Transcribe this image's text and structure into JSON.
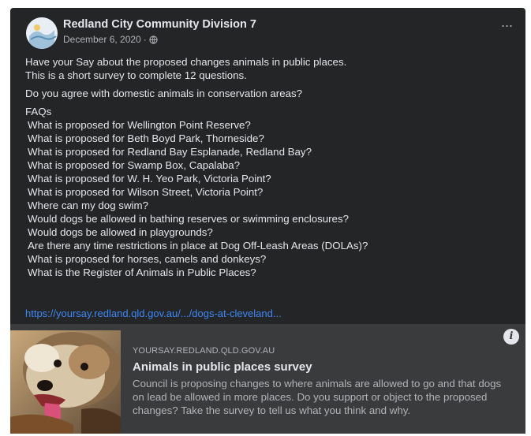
{
  "post": {
    "page_name": "Redland City Community Division 7",
    "date": "December 6, 2020",
    "separator": "·",
    "privacy_icon": "globe-icon",
    "more_icon": "more-options-icon",
    "more_label": "···",
    "intro_line1": "Have your Say about the proposed changes animals in public places.",
    "intro_line2": "This is a short survey to complete 12 questions.",
    "question": "Do you agree with domestic animals in conservation areas?",
    "faq_heading": "FAQs",
    "faqs": [
      "What is proposed for Wellington Point Reserve?",
      "What is proposed for Beth Boyd Park, Thorneside?",
      "What is proposed for Redland Bay Esplanade, Redland Bay?",
      "What is proposed for Swamp Box, Capalaba?",
      "What is proposed for W. H. Yeo Park, Victoria Point?",
      "What is proposed for Wilson Street, Victoria Point?",
      "Where can my dog swim?",
      "Would dogs be allowed in bathing reserves or swimming enclosures?",
      "Would dogs be allowed in playgrounds?",
      "Are there any time restrictions in place at Dog Off-Leash Areas (DOLAs)?",
      "What is proposed for horses, camels and donkeys?",
      "What is the Register of Animals in Public Places?"
    ],
    "link": "https://yoursay.redland.qld.gov.au/.../dogs-at-cleveland..."
  },
  "preview": {
    "domain": "YOURSAY.REDLAND.QLD.GOV.AU",
    "title": "Animals in public places survey",
    "description": "Council is proposing changes to where animals are allowed to go and that dogs on lead be allowed in more places. Do you support or object to the proposed changes? Take the survey to tell us what you think and why.",
    "info_label": "i",
    "image_icon": "dog-photo"
  },
  "colors": {
    "card_bg": "#242526",
    "preview_bg": "#3a3b3c",
    "text_primary": "#e4e6eb",
    "text_secondary": "#b0b3b8",
    "link": "#3f86f5"
  }
}
